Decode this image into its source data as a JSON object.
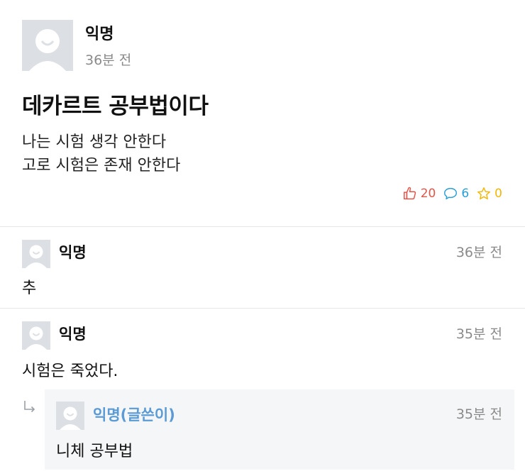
{
  "post": {
    "author": "익명",
    "time": "36분 전",
    "title": "데카르트 공부법이다",
    "body_lines": [
      "나는 시험 생각 안한다",
      "고로 시험은 존재 안한다"
    ],
    "likes": "20",
    "comments": "6",
    "scraps": "0"
  },
  "comments": [
    {
      "author": "익명",
      "time": "36분 전",
      "text": "추"
    },
    {
      "author": "익명",
      "time": "35분 전",
      "text": "시험은 죽었다."
    }
  ],
  "reply": {
    "author": "익명(글쓴이)",
    "time": "35분 전",
    "text": "니체 공부법"
  },
  "colors": {
    "like": "#e2564a",
    "comment": "#2a9fd6",
    "scrap": "#f2b705",
    "op_name": "#5b9bd5",
    "avatar_bg": "#dcdfe3"
  },
  "icons": {
    "like": "thumbs-up-icon",
    "comment": "speech-bubble-icon",
    "scrap": "star-icon",
    "reply": "reply-arrow-icon",
    "avatar": "default-avatar-icon"
  }
}
